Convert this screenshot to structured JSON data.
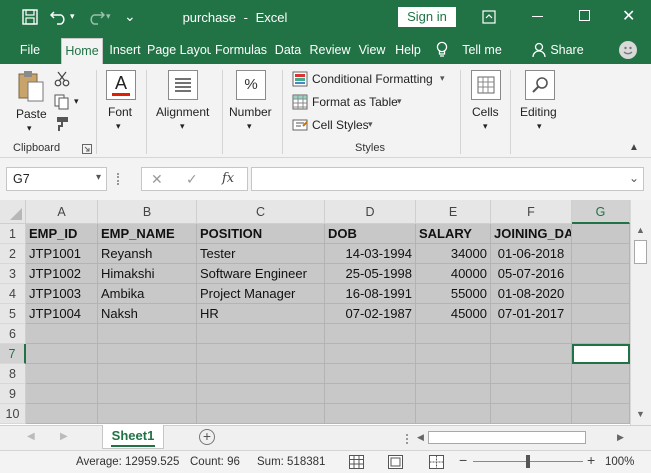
{
  "titlebar": {
    "filename": "purchase",
    "separator": "-",
    "app": "Excel",
    "signin": "Sign in"
  },
  "tabs": [
    "File",
    "Home",
    "Insert",
    "Page Layou",
    "Formulas",
    "Data",
    "Review",
    "View",
    "Help"
  ],
  "tellme": "Tell me",
  "share": "Share",
  "ribbon": {
    "paste": "Paste",
    "clipboard": "Clipboard",
    "font": "Font",
    "alignment": "Alignment",
    "number": "Number",
    "number_icon": "%",
    "font_icon": "A",
    "conditional": "Conditional Formatting",
    "format_table": "Format as Table",
    "cell_styles": "Cell Styles",
    "styles": "Styles",
    "cells": "Cells",
    "editing": "Editing"
  },
  "formula_bar": {
    "name_box": "G7",
    "fx": "fx",
    "value": ""
  },
  "columns": [
    "A",
    "B",
    "C",
    "D",
    "E",
    "F",
    "G"
  ],
  "rows": [
    "1",
    "2",
    "3",
    "4",
    "5",
    "6",
    "7",
    "8",
    "9",
    "10"
  ],
  "cells": [
    [
      "EMP_ID",
      "EMP_NAME",
      "POSITION",
      "DOB",
      "SALARY",
      "JOINING_DATE",
      ""
    ],
    [
      "JTP1001",
      "Reyansh",
      "Tester",
      "14-03-1994",
      "34000",
      "01-06-2018",
      ""
    ],
    [
      "JTP1002",
      "Himakshi",
      "Software Engineer",
      "25-05-1998",
      "40000",
      "05-07-2016",
      ""
    ],
    [
      "JTP1003",
      "Ambika",
      "Project Manager",
      "16-08-1991",
      "55000",
      "01-08-2020",
      ""
    ],
    [
      "JTP1004",
      "Naksh",
      "HR",
      "07-02-1987",
      "45000",
      "07-01-2017",
      ""
    ]
  ],
  "sheet_tab": "Sheet1",
  "status": {
    "average": "Average: 12959.525",
    "count": "Count: 96",
    "sum": "Sum: 518381",
    "zoom": "100%"
  }
}
